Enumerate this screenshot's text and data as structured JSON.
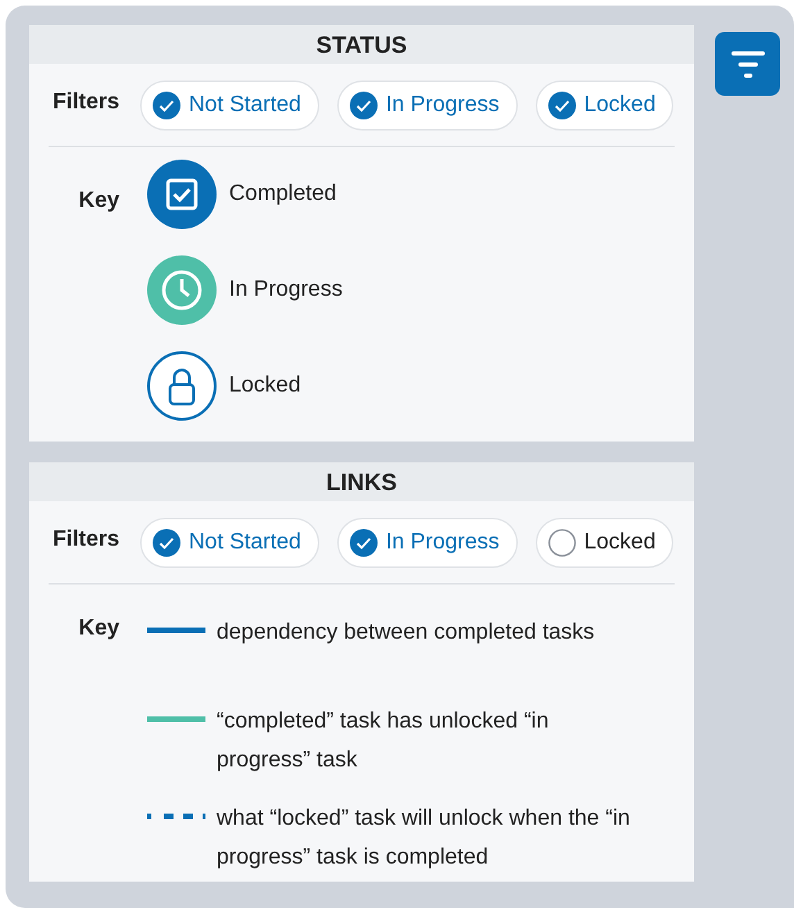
{
  "sections": [
    {
      "title": "STATUS",
      "filters_label": "Filters",
      "filters": [
        {
          "label": "Not Started",
          "checked": true
        },
        {
          "label": "In Progress",
          "checked": true
        },
        {
          "label": "Locked",
          "checked": true
        }
      ],
      "key_label": "Key",
      "key": [
        {
          "kind": "completed",
          "label": "Completed"
        },
        {
          "kind": "in_progress",
          "label": "In Progress"
        },
        {
          "kind": "locked",
          "label": "Locked"
        }
      ]
    },
    {
      "title": "LINKS",
      "filters_label": "Filters",
      "filters": [
        {
          "label": "Not Started",
          "checked": true
        },
        {
          "label": "In Progress",
          "checked": true
        },
        {
          "label": "Locked",
          "checked": false
        }
      ],
      "key_label": "Key",
      "key": [
        {
          "kind": "solid",
          "color": "#0a6fb5",
          "label": "dependency between completed tasks"
        },
        {
          "kind": "solid",
          "color": "#4fbfa8",
          "label": "“completed” task has unlocked “in progress” task"
        },
        {
          "kind": "dashed",
          "color": "#0a6fb5",
          "label": "what “locked” task will unlock when the “in progress” task is completed"
        }
      ]
    }
  ]
}
